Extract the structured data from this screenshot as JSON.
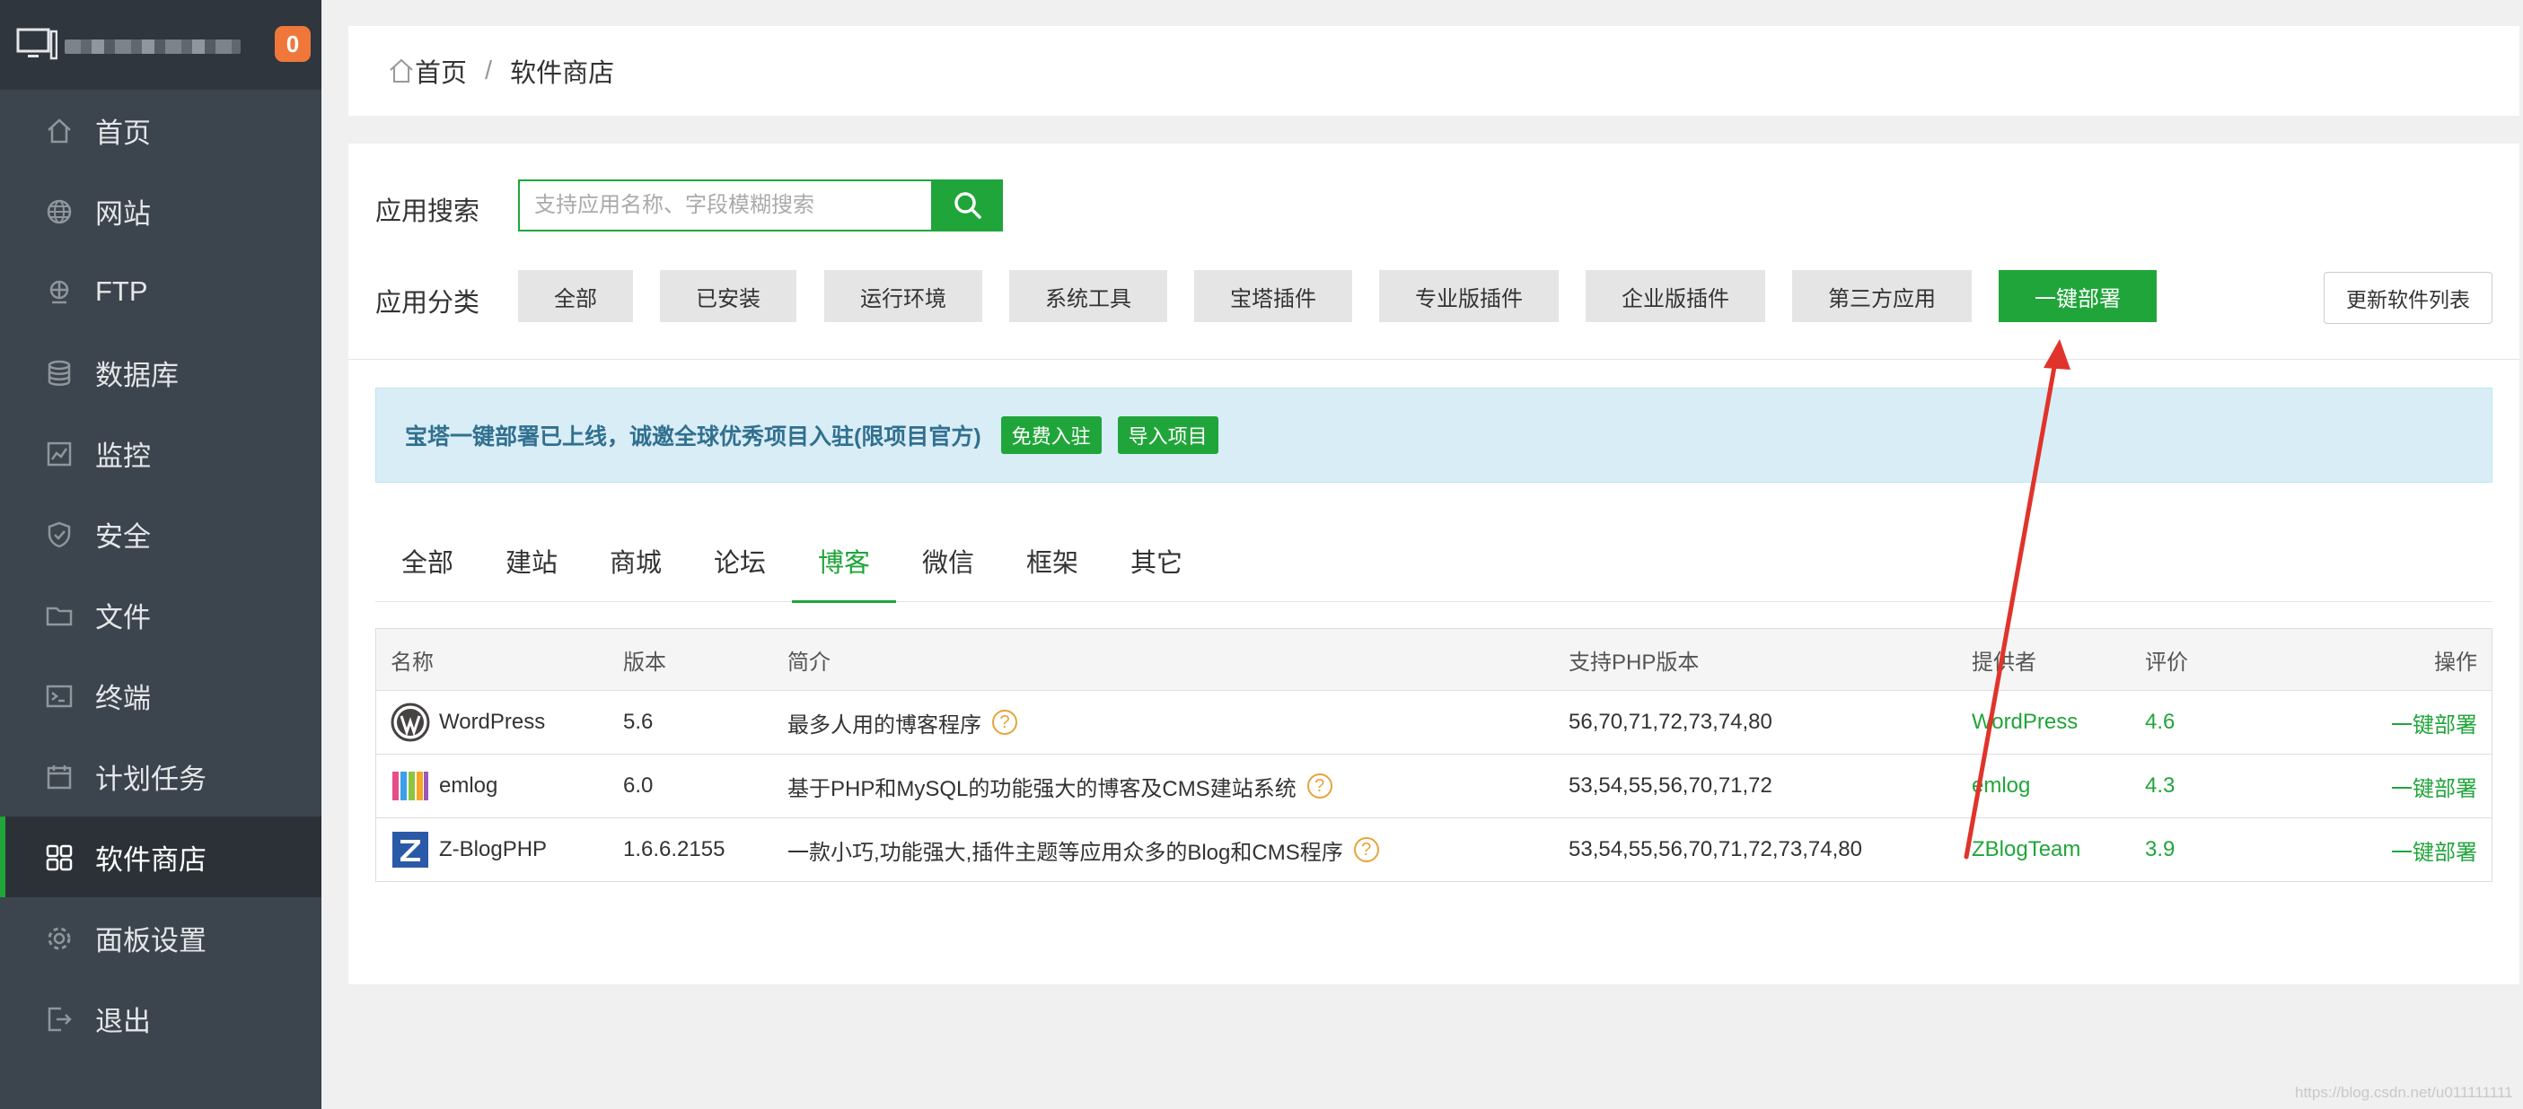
{
  "sidebar": {
    "badge": "0",
    "items": [
      {
        "label": "首页",
        "icon": "home-icon"
      },
      {
        "label": "网站",
        "icon": "globe-icon"
      },
      {
        "label": "FTP",
        "icon": "ftp-icon"
      },
      {
        "label": "数据库",
        "icon": "database-icon"
      },
      {
        "label": "监控",
        "icon": "monitor-icon"
      },
      {
        "label": "安全",
        "icon": "shield-icon"
      },
      {
        "label": "文件",
        "icon": "folder-icon"
      },
      {
        "label": "终端",
        "icon": "terminal-icon"
      },
      {
        "label": "计划任务",
        "icon": "calendar-icon"
      },
      {
        "label": "软件商店",
        "icon": "grid-icon"
      },
      {
        "label": "面板设置",
        "icon": "gear-icon"
      },
      {
        "label": "退出",
        "icon": "logout-icon"
      }
    ],
    "active_index": 9
  },
  "breadcrumb": {
    "home": "首页",
    "separator": "/",
    "current": "软件商店"
  },
  "search": {
    "label": "应用搜索",
    "placeholder": "支持应用名称、字段模糊搜索"
  },
  "categories": {
    "label": "应用分类",
    "items": [
      "全部",
      "已安装",
      "运行环境",
      "系统工具",
      "宝塔插件",
      "专业版插件",
      "企业版插件",
      "第三方应用",
      "一键部署"
    ],
    "active": "一键部署",
    "refresh": "更新软件列表"
  },
  "notice": {
    "text": "宝塔一键部署已上线，诚邀全球优秀项目入驻(限项目官方)",
    "btn1": "免费入驻",
    "btn2": "导入项目"
  },
  "tabs": {
    "items": [
      "全部",
      "建站",
      "商城",
      "论坛",
      "博客",
      "微信",
      "框架",
      "其它"
    ],
    "active": "博客"
  },
  "table": {
    "headers": [
      "名称",
      "版本",
      "简介",
      "支持PHP版本",
      "提供者",
      "评价",
      "操作"
    ],
    "rows": [
      {
        "name": "WordPress",
        "version": "5.6",
        "desc": "最多人用的博客程序",
        "php": "56,70,71,72,73,74,80",
        "provider": "WordPress",
        "rating": "4.6",
        "action": "一键部署"
      },
      {
        "name": "emlog",
        "version": "6.0",
        "desc": "基于PHP和MySQL的功能强大的博客及CMS建站系统",
        "php": "53,54,55,56,70,71,72",
        "provider": "emlog",
        "rating": "4.3",
        "action": "一键部署"
      },
      {
        "name": "Z-BlogPHP",
        "version": "1.6.6.2155",
        "desc": "一款小巧,功能强大,插件主题等应用众多的Blog和CMS程序",
        "php": "53,54,55,56,70,71,72,73,74,80",
        "provider": "ZBlogTeam",
        "rating": "3.9",
        "action": "一键部署"
      }
    ],
    "help_glyph": "?"
  },
  "watermark": "https://blog.csdn.net/u011111111",
  "colors": {
    "accent": "#20a53a",
    "sidebar": "#3c444d",
    "arrow": "#e0332b",
    "badge": "#f0773a"
  }
}
